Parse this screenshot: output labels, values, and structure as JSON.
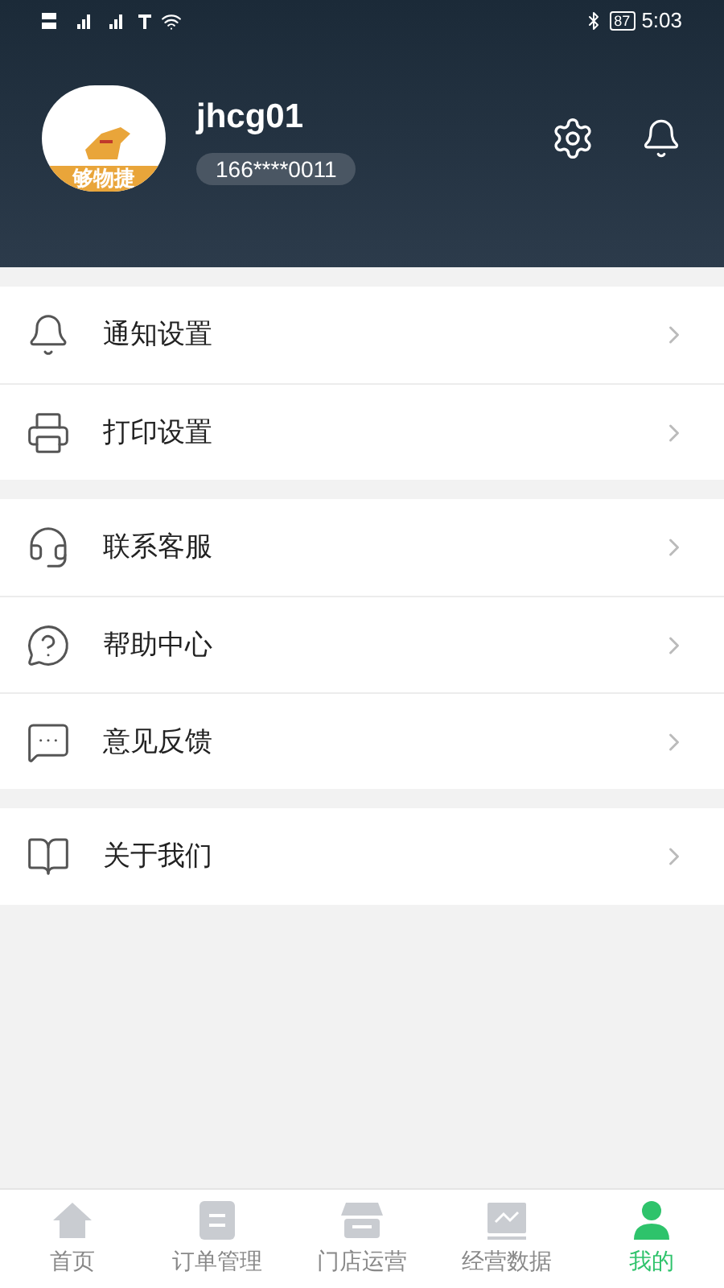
{
  "status_bar": {
    "battery": "87",
    "time": "5:03"
  },
  "profile": {
    "avatar_text": "够物捷",
    "username": "jhcg01",
    "phone": "166****0011"
  },
  "menu_groups": [
    {
      "items": [
        {
          "label": "通知设置"
        },
        {
          "label": "打印设置"
        }
      ]
    },
    {
      "items": [
        {
          "label": "联系客服"
        },
        {
          "label": "帮助中心"
        },
        {
          "label": "意见反馈"
        }
      ]
    },
    {
      "items": [
        {
          "label": "关于我们"
        }
      ]
    }
  ],
  "tab_bar": [
    {
      "label": "首页",
      "selected": false
    },
    {
      "label": "订单管理",
      "selected": false
    },
    {
      "label": "门店运营",
      "selected": false
    },
    {
      "label": "经营数据",
      "selected": false
    },
    {
      "label": "我的",
      "selected": true
    }
  ]
}
